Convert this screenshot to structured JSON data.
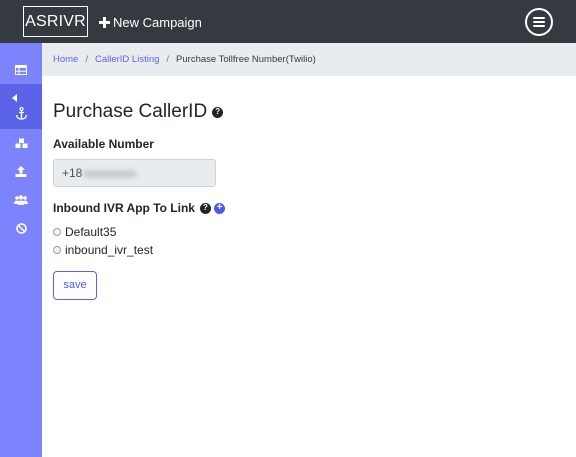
{
  "topbar": {
    "brand": "ASRIVR",
    "new_campaign": "New Campaign",
    "menu_icon": "hamburger-circle-icon"
  },
  "sidebar": {
    "items": [
      {
        "icon": "table-icon"
      },
      {
        "icon": "anchor-icon",
        "active": true
      },
      {
        "icon": "cubes-icon"
      },
      {
        "icon": "upload-icon"
      },
      {
        "icon": "users-icon"
      },
      {
        "icon": "ban-icon"
      }
    ],
    "color": "#7c83fd"
  },
  "breadcrumb": {
    "home": "Home",
    "listing": "CallerID Listing",
    "current": "Purchase Tollfree Number(Twilio)"
  },
  "page": {
    "title": "Purchase CallerID",
    "available_label": "Available Number",
    "number_value": "+18",
    "inbound_label": "Inbound IVR App To Link",
    "apps": [
      "Default35",
      "inbound_ivr_test"
    ],
    "save_label": "save"
  },
  "colors": {
    "topbar": "#343a40",
    "accent": "#5a64ea"
  }
}
